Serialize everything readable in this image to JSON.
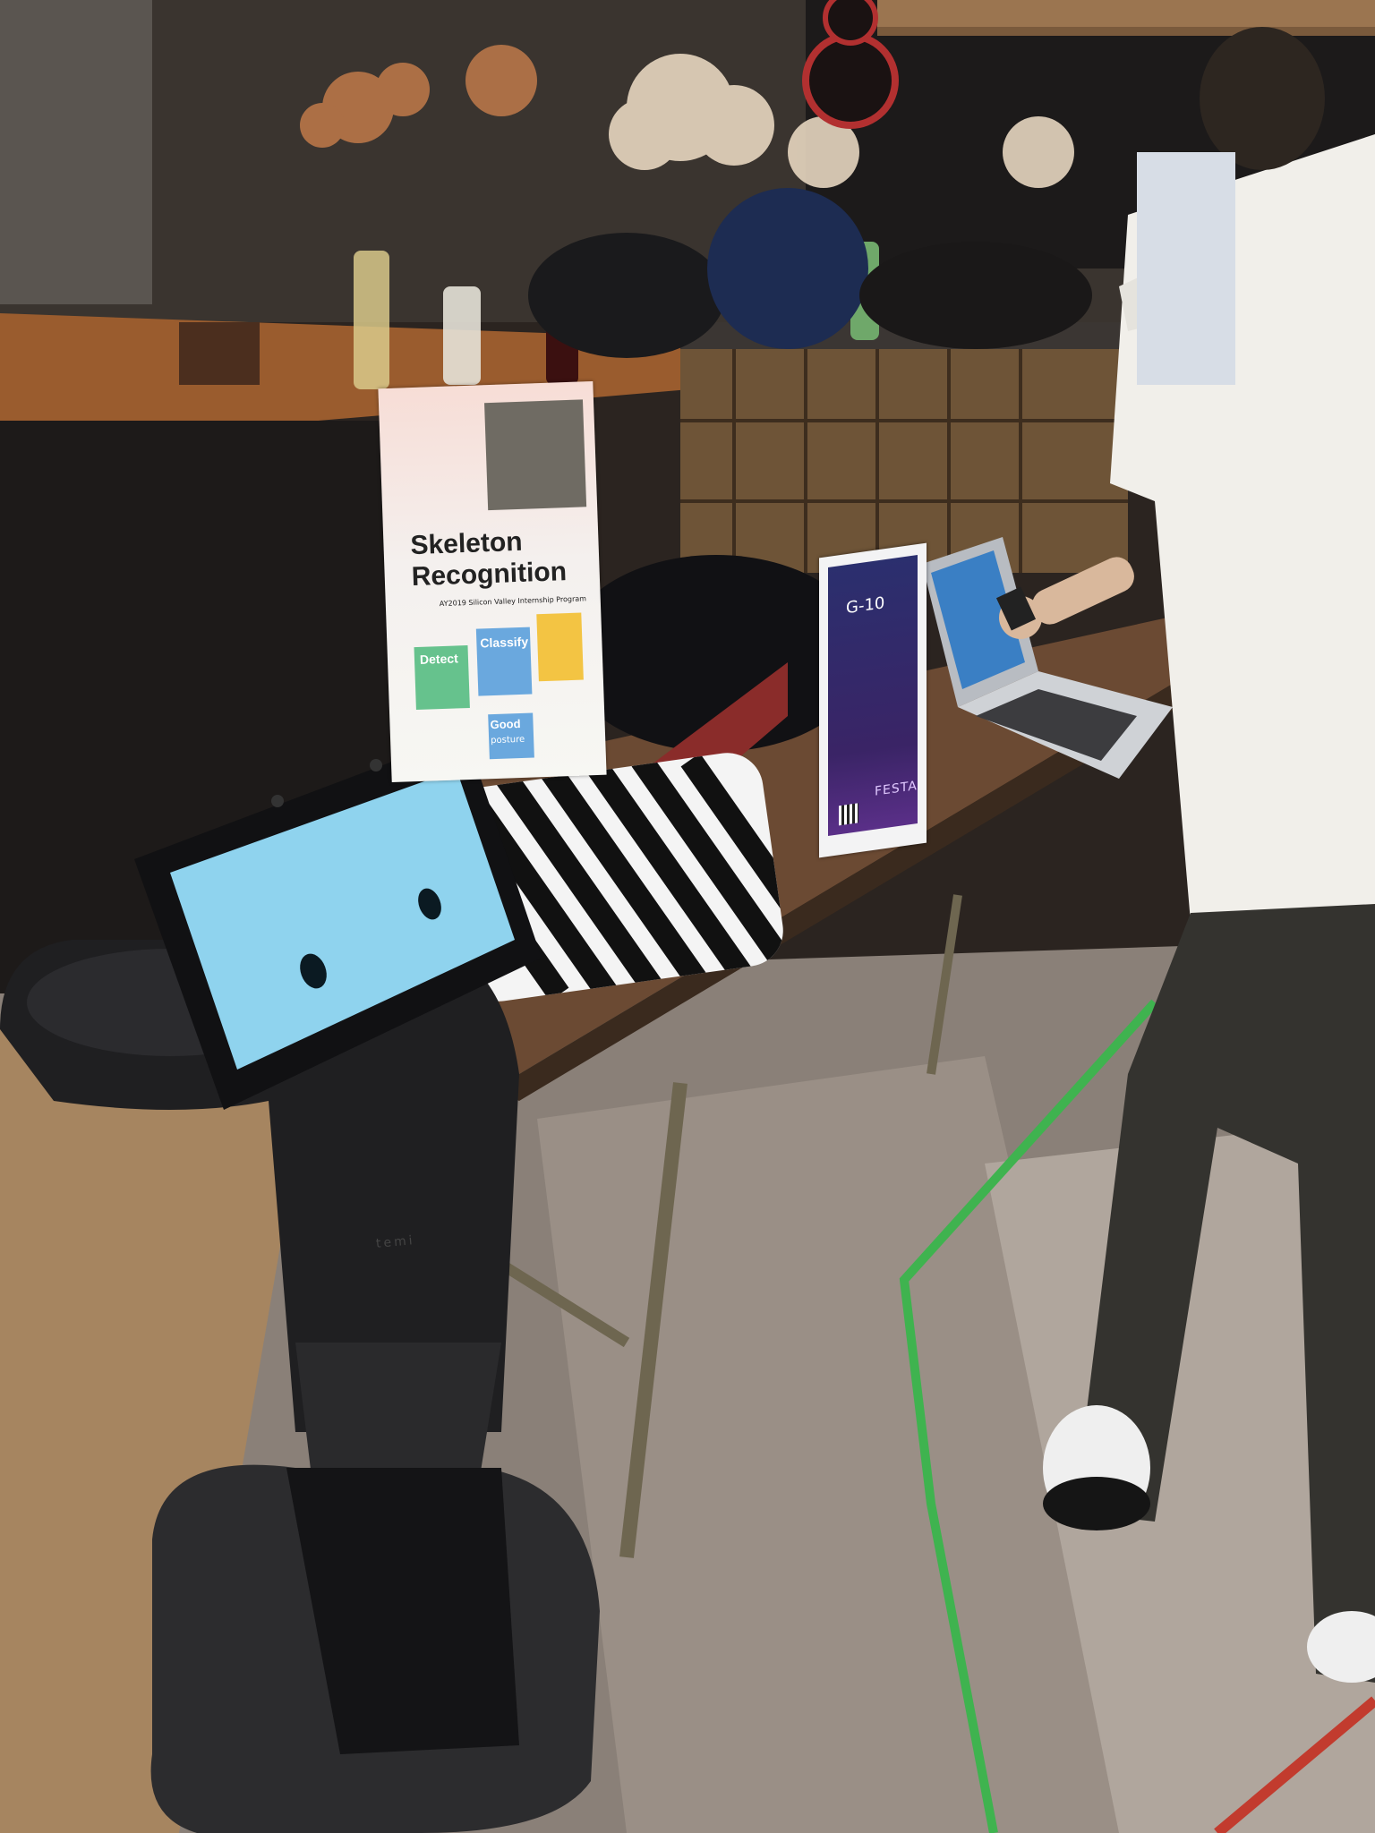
{
  "photo": {
    "poster": {
      "title_line1": "Skeleton",
      "title_line2": "Recognition",
      "subtitle": "AY2019 Silicon Valley Internship Program",
      "box_detect": "Detect",
      "box_classify": "Classify",
      "box_good": "Good",
      "box_good_sub": "posture"
    },
    "table_card": {
      "code": "G-10",
      "brand": "FESTA"
    },
    "robot": {
      "brand": "temi"
    }
  }
}
